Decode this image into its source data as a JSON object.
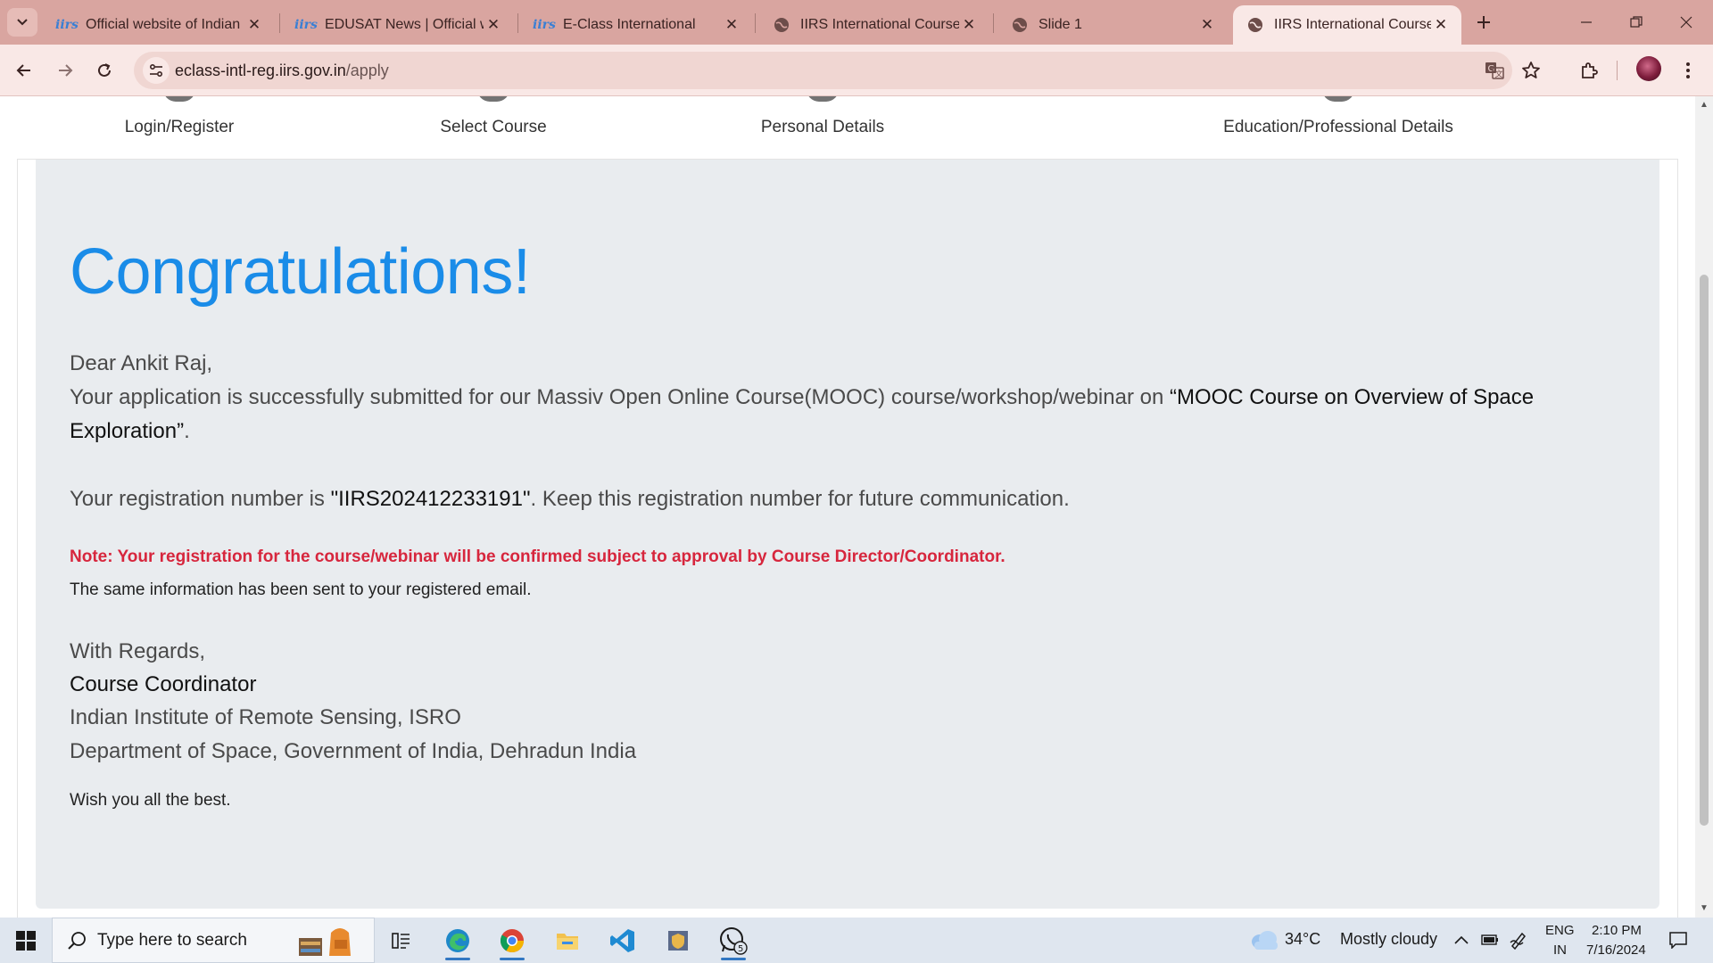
{
  "browser": {
    "tabs": [
      {
        "title": "Official website of Indian In",
        "favicon": "iirs",
        "active": false
      },
      {
        "title": "EDUSAT News | Official web",
        "favicon": "iirs",
        "active": false
      },
      {
        "title": "E-Class International",
        "favicon": "iirs",
        "active": false
      },
      {
        "title": "IIRS International Course",
        "favicon": "globe",
        "active": false
      },
      {
        "title": "Slide 1",
        "favicon": "globe",
        "active": false
      },
      {
        "title": "IIRS International Course",
        "favicon": "globe",
        "active": true
      }
    ],
    "favicon_text": "iirs",
    "url_host": "eclass-intl-reg.iirs.gov.in",
    "url_path": "/apply"
  },
  "steps": [
    {
      "label": "Login/Register"
    },
    {
      "label": "Select Course"
    },
    {
      "label": "Personal Details"
    },
    {
      "label": "Education/Professional Details"
    }
  ],
  "content": {
    "heading": "Congratulations!",
    "greeting": "Dear Ankit Raj,",
    "para1_prefix": "Your application is successfully submitted for our Massiv Open Online Course(MOOC) course/workshop/webinar on ",
    "course_name": "“MOOC Course on Overview of Space Exploration”",
    "para1_suffix": ".",
    "reg_prefix": "Your registration number is ",
    "reg_number": "\"IIRS202412233191\"",
    "reg_suffix": ". Keep this registration number for future communication.",
    "note": "Note: Your registration for the course/webinar will be confirmed subject to approval by Course Director/Coordinator.",
    "email_info": "The same information has been sent to your registered email.",
    "regards": "With Regards,",
    "signatory": "Course Coordinator",
    "institute": "Indian Institute of Remote Sensing, ISRO",
    "department": "Department of Space, Government of India, Dehradun India",
    "wish": "Wish you all the best."
  },
  "taskbar": {
    "search_placeholder": "Type here to search",
    "weather_temp": "34°C",
    "weather_desc": "Mostly cloudy",
    "lang_top": "ENG",
    "lang_bottom": "IN",
    "time": "2:10 PM",
    "date": "7/16/2024",
    "whatsapp_badge": "5"
  },
  "colors": {
    "accent_blue": "#1a8ce8",
    "note_red": "#d7263d",
    "tabstrip": "#d9a5a0",
    "panel_bg": "#e9ecef"
  }
}
